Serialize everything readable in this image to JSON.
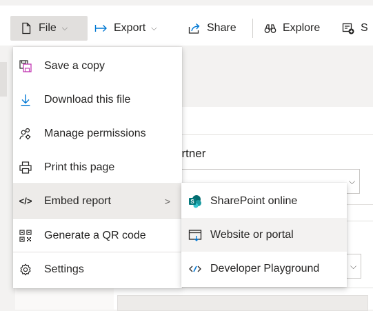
{
  "toolbar": {
    "file_label": "File",
    "export_label": "Export",
    "share_label": "Share",
    "explore_label": "Explore",
    "partial_label": "S"
  },
  "background": {
    "partner_label": "artner"
  },
  "file_menu": {
    "items": [
      {
        "label": "Save a copy",
        "icon": "save-copy-icon"
      },
      {
        "label": "Download this file",
        "icon": "download-icon"
      },
      {
        "label": "Manage permissions",
        "icon": "manage-permissions-icon"
      },
      {
        "label": "Print this page",
        "icon": "print-icon"
      },
      {
        "label": "Embed report",
        "icon": "embed-code-icon",
        "has_submenu": true
      },
      {
        "label": "Generate a QR code",
        "icon": "qr-code-icon"
      },
      {
        "label": "Settings",
        "icon": "gear-icon"
      }
    ]
  },
  "embed_submenu": {
    "items": [
      {
        "label": "SharePoint online",
        "icon": "sharepoint-icon"
      },
      {
        "label": "Website or portal",
        "icon": "website-icon"
      },
      {
        "label": "Developer Playground",
        "icon": "developer-icon"
      }
    ]
  },
  "colors": {
    "accent": "#0078d4",
    "sharepoint": "#038387",
    "highlight": "#edebe9"
  }
}
